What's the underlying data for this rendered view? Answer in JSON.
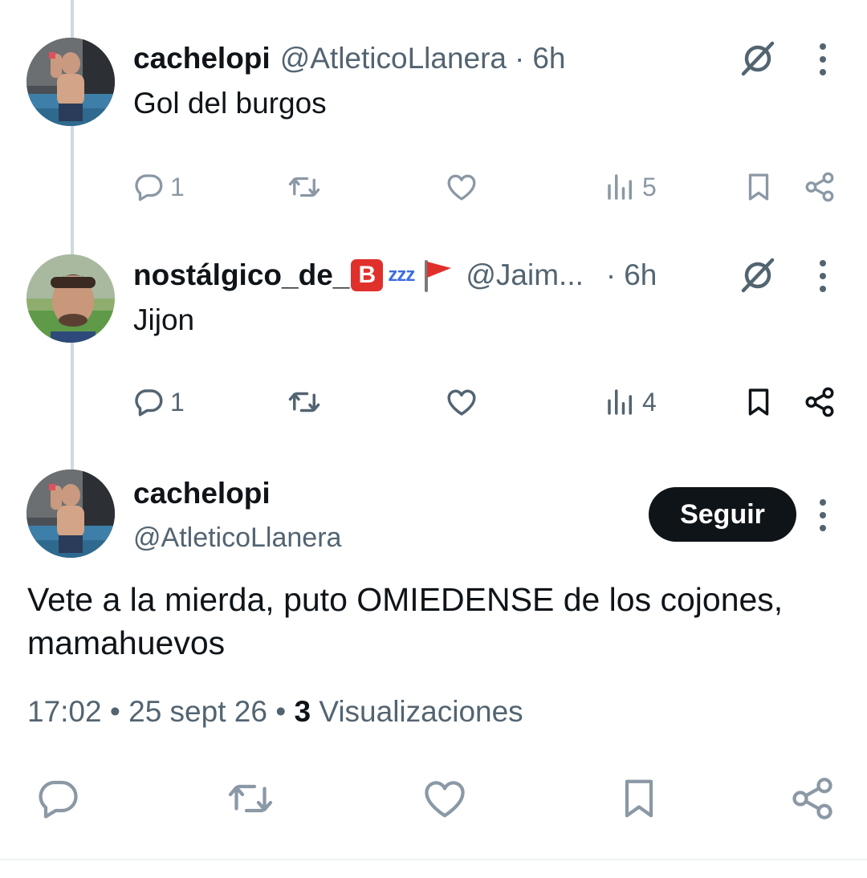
{
  "replies": [
    {
      "display_name": "cachelopi",
      "handle": "@AtleticoLlanera",
      "separator": "·",
      "time": "6h",
      "text": "Gol del burgos",
      "replies_count": "1",
      "views_count": "5"
    },
    {
      "display_name": "nostálgico_de_",
      "name_emoji_letter": "B",
      "name_emoji_zzz": "zzz",
      "handle": "@Jaim...",
      "separator": "·",
      "time": "6h",
      "text": "Jijon",
      "replies_count": "1",
      "views_count": "4"
    }
  ],
  "main_tweet": {
    "display_name": "cachelopi",
    "handle": "@AtleticoLlanera",
    "follow_label": "Seguir",
    "text": "Vete a la mierda, puto OMIEDENSE de los cojones, mamahuevos",
    "time": "17:02",
    "dot": "•",
    "date": "25 sept 26",
    "views_count": "3",
    "views_label": "Visualizaciones"
  },
  "icons": {
    "reply": "reply-icon",
    "retweet": "retweet-icon",
    "like": "like-icon",
    "views": "views-icon",
    "bookmark": "bookmark-icon",
    "share": "share-icon",
    "grok": "grok-icon",
    "more": "more-icon"
  },
  "colors": {
    "text": "#0f1419",
    "secondary": "#536471",
    "thread_line": "#cfd9de",
    "follow_bg": "#0f1419",
    "faded_icon": "#8b98a5"
  }
}
